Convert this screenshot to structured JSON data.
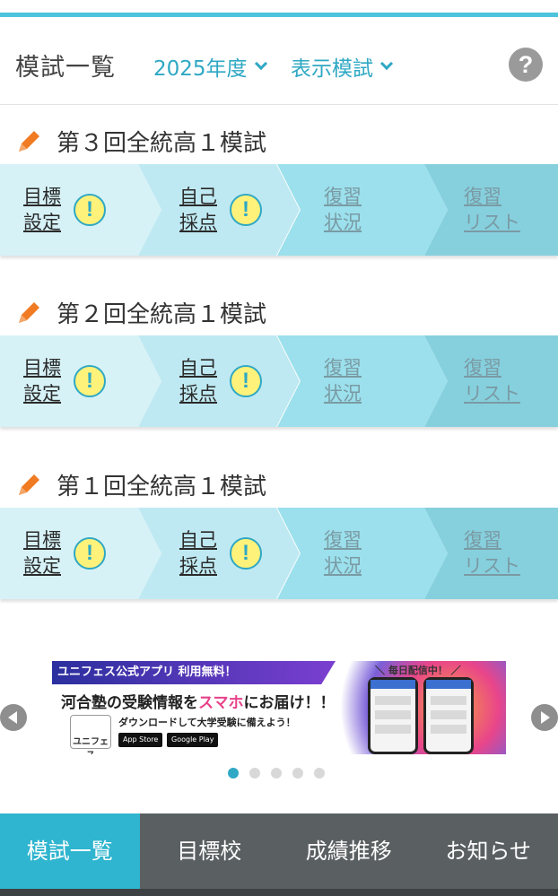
{
  "colors": {
    "accent": "#2fa8c4",
    "step1": "#d6f2f7",
    "step2": "#bfe9f2",
    "step3": "#9be0ec",
    "step4": "#86d0de",
    "pencil": "#f07b22",
    "tabbar": "#5a5f62",
    "tab_active": "#2fb5cf"
  },
  "header": {
    "title": "模試一覧",
    "year_label": "2025年度",
    "filter_label": "表示模試",
    "help_symbol": "?"
  },
  "exams": [
    {
      "title": "第３回全統高１模試",
      "steps": [
        {
          "line1": "目標",
          "line2": "設定",
          "warning": true,
          "active": true
        },
        {
          "line1": "自己",
          "line2": "採点",
          "warning": true,
          "active": true
        },
        {
          "line1": "復習",
          "line2": "状況",
          "warning": false,
          "active": false
        },
        {
          "line1": "復習",
          "line2": "リスト",
          "warning": false,
          "active": false
        }
      ]
    },
    {
      "title": "第２回全統高１模試",
      "steps": [
        {
          "line1": "目標",
          "line2": "設定",
          "warning": true,
          "active": true
        },
        {
          "line1": "自己",
          "line2": "採点",
          "warning": true,
          "active": true
        },
        {
          "line1": "復習",
          "line2": "状況",
          "warning": false,
          "active": false
        },
        {
          "line1": "復習",
          "line2": "リスト",
          "warning": false,
          "active": false
        }
      ]
    },
    {
      "title": "第１回全統高１模試",
      "steps": [
        {
          "line1": "目標",
          "line2": "設定",
          "warning": true,
          "active": true
        },
        {
          "line1": "自己",
          "line2": "採点",
          "warning": true,
          "active": true
        },
        {
          "line1": "復習",
          "line2": "状況",
          "warning": false,
          "active": false
        },
        {
          "line1": "復習",
          "line2": "リスト",
          "warning": false,
          "active": false
        }
      ]
    }
  ],
  "warning_symbol": "!",
  "banner": {
    "ribbon": "ユニフェス公式アプリ 利用無料！",
    "main_prefix": "河合塾の受験情報を",
    "main_accent": "スマホ",
    "main_suffix": "にお届け！！",
    "sub": "ダウンロードして大学受験に備えよう！",
    "logo": "ユニフェス",
    "app_store": "App Store",
    "google_play": "Google Play",
    "daily": "＼ 毎日配信中！ ／"
  },
  "carousel": {
    "dot_count": 5,
    "active_index": 0
  },
  "tabs": [
    {
      "label": "模試一覧",
      "active": true
    },
    {
      "label": "目標校",
      "active": false
    },
    {
      "label": "成績推移",
      "active": false
    },
    {
      "label": "お知らせ",
      "active": false
    }
  ]
}
